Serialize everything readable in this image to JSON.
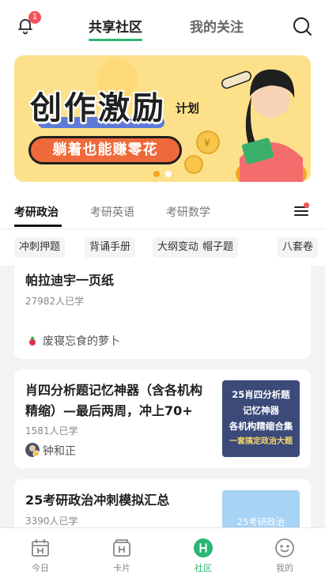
{
  "header": {
    "notification_count": "1",
    "tabs": [
      {
        "label": "共享社区",
        "active": true
      },
      {
        "label": "我的关注",
        "active": false
      }
    ],
    "accent_color": "#2bb673"
  },
  "banner": {
    "title": "创作激励",
    "title_suffix": "计划",
    "button_text": "躺着也能赚零花",
    "background_color": "#fde08a",
    "slide_count": 2,
    "active_slide": 1
  },
  "subject_tabs": [
    {
      "label": "考研政治",
      "active": true
    },
    {
      "label": "考研英语",
      "active": false
    },
    {
      "label": "考研数学",
      "active": false
    }
  ],
  "chips": [
    "冲刺押题",
    "背诵手册",
    "大纲变动",
    "帽子题",
    "八套卷"
  ],
  "cards": [
    {
      "title": "帕拉迪宇一页纸",
      "count": "27982人已学",
      "author": "废寝忘食的萝卜"
    },
    {
      "title_line1": "肖四分析题记忆神器（含各机构",
      "title_line2": "精缩）—最后两周，冲上70+",
      "count": "1581人已学",
      "author": "钟和正",
      "thumb_lines": [
        "25肖四分析题",
        "记忆神器",
        "各机构精缩合集",
        "一套搞定政治大题"
      ]
    },
    {
      "title": "25考研政治冲刺模拟汇总",
      "count": "3390人已学",
      "thumb_text": "25考研政治"
    }
  ],
  "bottom_nav": [
    {
      "label": "今日",
      "icon": "calendar-icon",
      "active": false
    },
    {
      "label": "卡片",
      "icon": "card-icon",
      "active": false
    },
    {
      "label": "社区",
      "icon": "community-icon",
      "active": true
    },
    {
      "label": "我的",
      "icon": "smile-icon",
      "active": false
    }
  ]
}
